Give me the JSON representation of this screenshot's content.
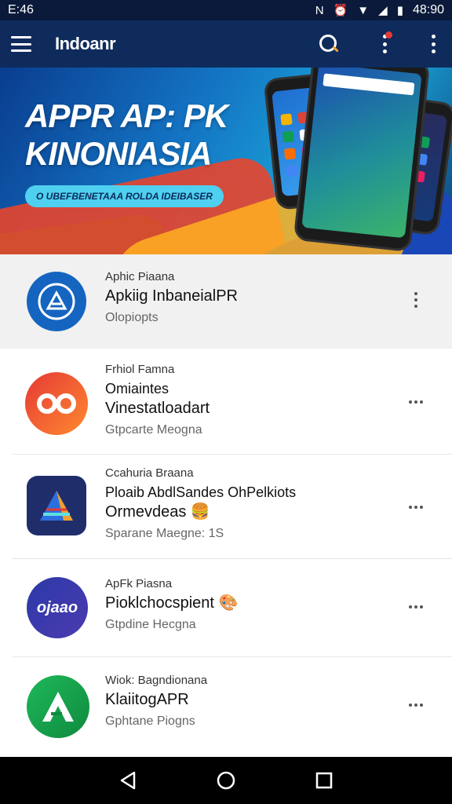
{
  "status_bar": {
    "time": "E:46",
    "right_time": "48:90"
  },
  "app_bar": {
    "title": "Indoanr"
  },
  "banner": {
    "title_line1": "APPR AP: PK",
    "title_line2": "KINONIASIA",
    "pill_text": "O UBEFBENETAAA ROLDA IDEIBASER"
  },
  "apps": [
    {
      "category": "Aphic Piaana",
      "lines": [
        "Apkiig InbaneialPR"
      ],
      "sub": "Olopiopts",
      "icon": "a-triangle-icon",
      "icon_color": "#1565c0"
    },
    {
      "category": "Frhiol Famna",
      "lines": [
        "Omiaintes",
        "Vinestatloadart"
      ],
      "sub": "Gtpcarte Meogna",
      "icon": "chat-bubble-icon",
      "icon_color": "#f05a28"
    },
    {
      "category": "Ccahuria Braana",
      "lines": [
        "Ploaib AbdlSandes OhPelkiots",
        "Ormevdeas 🍔"
      ],
      "sub": "Sparane Maegne: 1S",
      "icon": "prism-a-icon",
      "icon_color": "#1f2e6b"
    },
    {
      "category": "ApFk Piasna",
      "lines": [
        "Pioklchocspient 🎨"
      ],
      "sub": "Gtpdine Hecgna",
      "icon": "text-logo-icon",
      "icon_text": "ojaao",
      "icon_color": "#3a3aa0"
    },
    {
      "category": "Wiok: Bagndionana",
      "lines": [
        "KlaiitogAPR"
      ],
      "sub": "Gphtane Piogns",
      "icon": "green-a-icon",
      "icon_color": "#1eaa5a"
    }
  ]
}
